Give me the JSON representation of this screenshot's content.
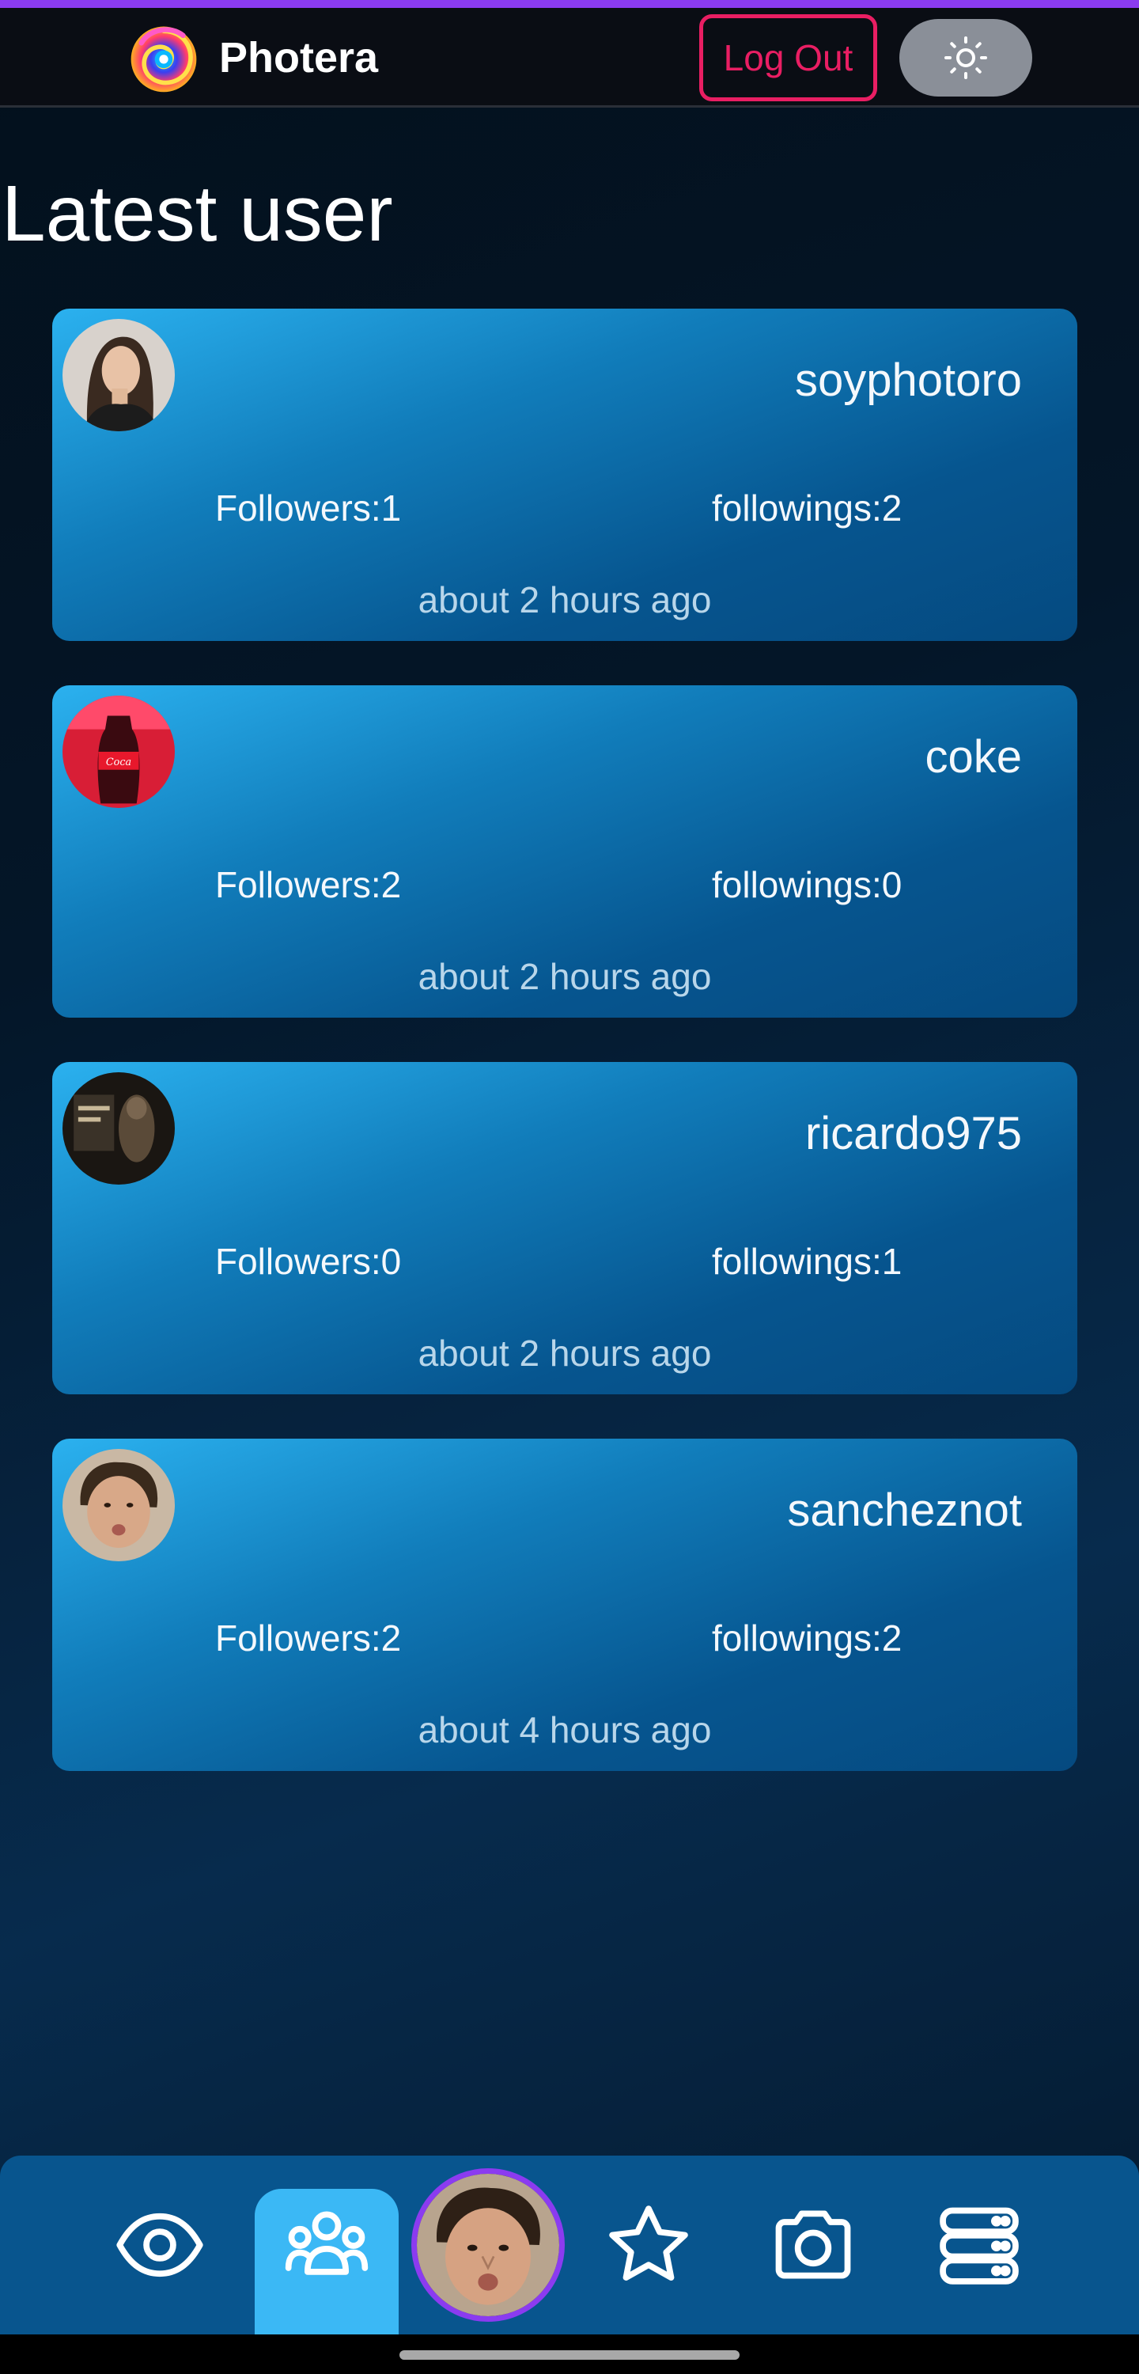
{
  "app": {
    "name": "Photera",
    "logout_label": "Log Out",
    "theme_icon": "sun-icon"
  },
  "page": {
    "title": "Latest user"
  },
  "users": [
    {
      "username": "soyphotoro",
      "followers": "Followers:1",
      "followings": "followings:2",
      "time": "about 2 hours ago"
    },
    {
      "username": "coke",
      "followers": "Followers:2",
      "followings": "followings:0",
      "time": "about 2 hours ago"
    },
    {
      "username": "ricardo975",
      "followers": "Followers:0",
      "followings": "followings:1",
      "time": "about 2 hours ago"
    },
    {
      "username": "sancheznot",
      "followers": "Followers:2",
      "followings": "followings:2",
      "time": "about 4 hours ago"
    }
  ],
  "nav": {
    "items": [
      {
        "icon": "eye-icon"
      },
      {
        "icon": "users-icon",
        "active": true
      },
      {
        "icon": "profile-avatar"
      },
      {
        "icon": "star-icon"
      },
      {
        "icon": "camera-icon"
      },
      {
        "icon": "server-icon"
      }
    ]
  },
  "colors": {
    "accent_purple": "#8b3bf0",
    "logout_pink": "#e91e63",
    "nav_active": "#3bb8f5",
    "nav_bg": "#08558e",
    "card_gradient_start": "#2bb1ef",
    "card_gradient_end": "#054a80"
  }
}
